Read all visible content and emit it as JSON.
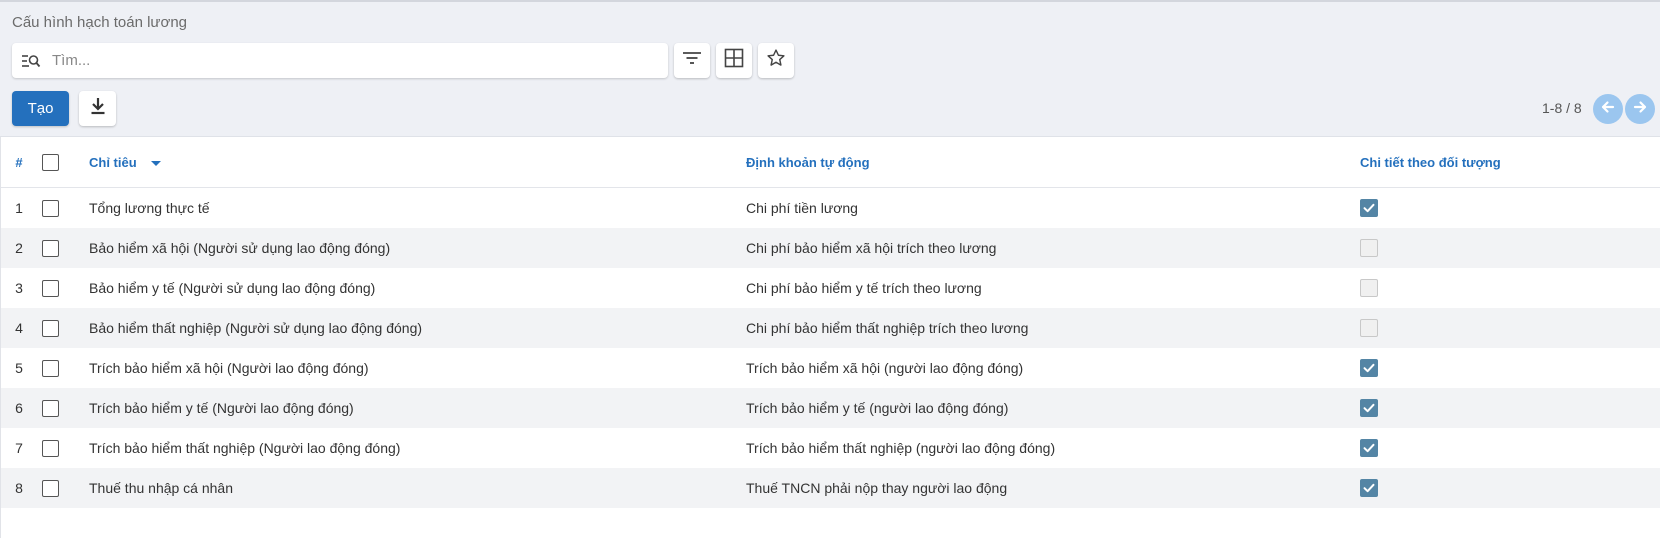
{
  "page": {
    "title": "Cấu hình hạch toán lương"
  },
  "search": {
    "placeholder": "Tìm..."
  },
  "toolbar": {
    "create_label": "Tạo"
  },
  "pager": {
    "text": "1-8 / 8"
  },
  "icons": {
    "search": "search-list-icon",
    "filter": "filter-icon",
    "group": "grid-icon",
    "favorite": "star-icon",
    "download": "download-icon",
    "prev": "arrow-left-icon",
    "next": "arrow-right-icon"
  },
  "colors": {
    "accent": "#2470bd",
    "checked_flag": "#5485a5",
    "pager": "#9bc6ef"
  },
  "table": {
    "headers": {
      "num": "#",
      "name": "Chỉ tiêu",
      "account": "Định khoản tự động",
      "detail": "Chi tiết theo đối tượng"
    },
    "sort": {
      "column": "name",
      "direction": "descending"
    },
    "rows": [
      {
        "num": "1",
        "name": "Tổng lương thực tế",
        "account": "Chi phí tiền lương",
        "detail": true
      },
      {
        "num": "2",
        "name": "Bảo hiểm xã hội (Người sử dụng lao động đóng)",
        "account": "Chi phí bảo hiểm xã hội trích theo lương",
        "detail": false
      },
      {
        "num": "3",
        "name": "Bảo hiểm y tế (Người sử dụng lao động đóng)",
        "account": "Chi phí bảo hiểm y tế trích theo lương",
        "detail": false
      },
      {
        "num": "4",
        "name": "Bảo hiểm thất nghiệp (Người sử dụng lao động đóng)",
        "account": "Chi phí bảo hiểm thất nghiệp trích theo lương",
        "detail": false
      },
      {
        "num": "5",
        "name": "Trích bảo hiểm xã hội (Người lao động đóng)",
        "account": "Trích bảo hiểm xã hội (người lao động đóng)",
        "detail": true
      },
      {
        "num": "6",
        "name": "Trích bảo hiểm y tế (Người lao động đóng)",
        "account": "Trích bảo hiểm y tế (người lao động đóng)",
        "detail": true
      },
      {
        "num": "7",
        "name": "Trích bảo hiểm thất nghiệp (Người lao động đóng)",
        "account": "Trích bảo hiểm thất nghiệp (người lao động đóng)",
        "detail": true
      },
      {
        "num": "8",
        "name": "Thuế thu nhập cá nhân",
        "account": "Thuế TNCN phải nộp thay người lao động",
        "detail": true
      }
    ]
  }
}
